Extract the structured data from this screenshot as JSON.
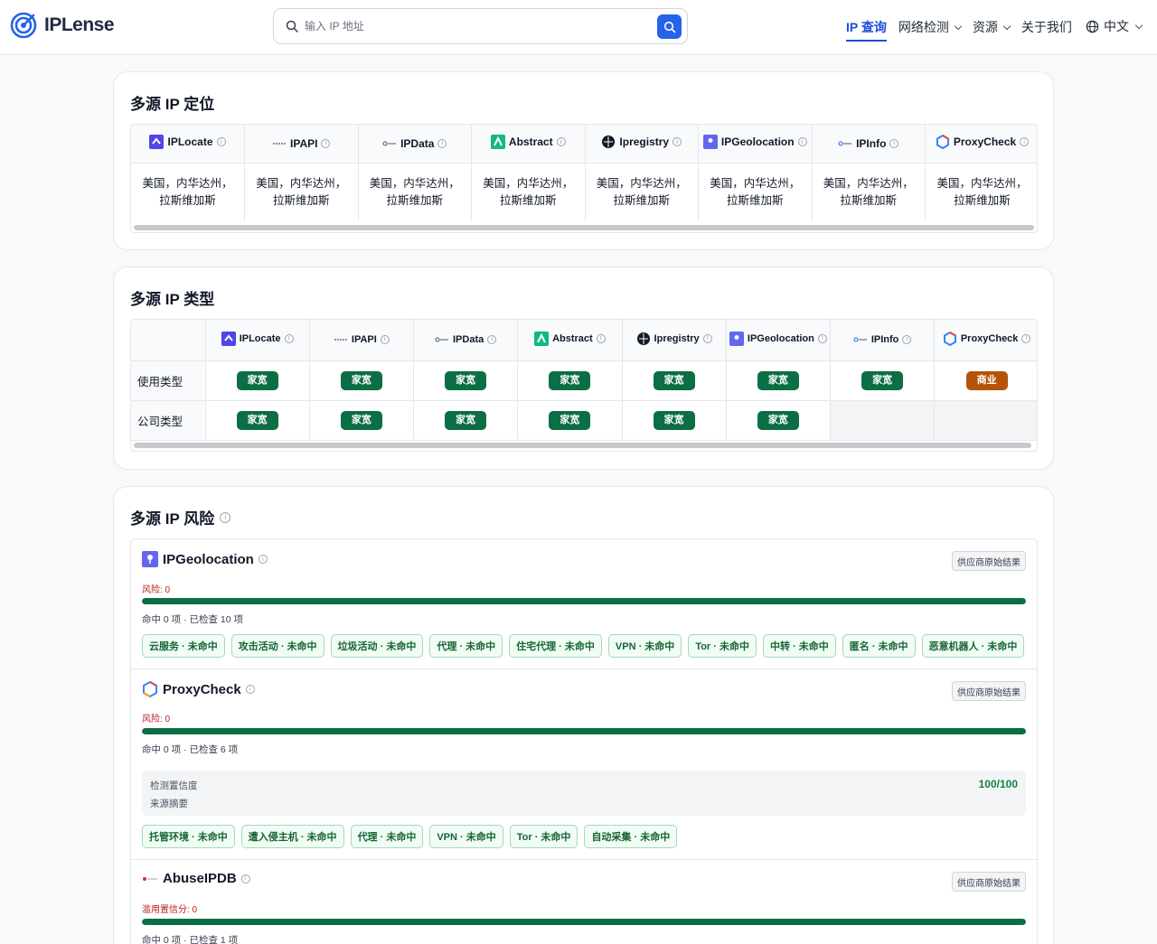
{
  "app": {
    "name": "IPLense"
  },
  "search": {
    "placeholder": "输入 IP 地址"
  },
  "nav": {
    "items": [
      {
        "label": "IP 查询",
        "active": true,
        "dropdown": false
      },
      {
        "label": "网络检测",
        "active": false,
        "dropdown": true
      },
      {
        "label": "资源",
        "active": false,
        "dropdown": true
      },
      {
        "label": "关于我们",
        "active": false,
        "dropdown": false
      }
    ],
    "language": "中文"
  },
  "providers": [
    "IPLocate",
    "IPAPI",
    "IPData",
    "Abstract",
    "Ipregistry",
    "IPGeolocation",
    "IPInfo",
    "ProxyCheck"
  ],
  "location_section": {
    "title": "多源 IP 定位",
    "values": [
      "美国，内华达州，拉斯维加斯",
      "美国，内华达州，拉斯维加斯",
      "美国，内华达州，拉斯维加斯",
      "美国，内华达州，拉斯维加斯",
      "美国，内华达州，拉斯维加斯",
      "美国，内华达州，拉斯维加斯",
      "美国，内华达州，拉斯维加斯",
      "美国，内华达州，拉斯维加斯"
    ]
  },
  "type_section": {
    "title": "多源 IP 类型",
    "rows": [
      {
        "label": "使用类型",
        "values": [
          "家宽",
          "家宽",
          "家宽",
          "家宽",
          "家宽",
          "家宽",
          "家宽",
          "商业"
        ]
      },
      {
        "label": "公司类型",
        "values": [
          "家宽",
          "家宽",
          "家宽",
          "家宽",
          "家宽",
          "家宽",
          "",
          ""
        ]
      }
    ]
  },
  "risk_section": {
    "title": "多源 IP 风险",
    "raw_button": "供应商原始结果",
    "items": [
      {
        "name": "IPGeolocation",
        "score_text": "风险: 0",
        "score": 0,
        "hits_text": "命中 0 项 · 已检查 10 项",
        "chips": [
          "云服务 · 未命中",
          "攻击活动 · 未命中",
          "垃圾活动 · 未命中",
          "代理 · 未命中",
          "住宅代理 · 未命中",
          "VPN · 未命中",
          "Tor · 未命中",
          "中转 · 未命中",
          "匿名 · 未命中",
          "恶意机器人 · 未命中"
        ]
      },
      {
        "name": "ProxyCheck",
        "score_text": "风险: 0",
        "score": 0,
        "hits_text": "命中 0 项 · 已检查 6 项",
        "confidence_label": "检测置信度",
        "confidence_value": "100/100",
        "source_summary": "来源摘要",
        "chips": [
          "托管环境 · 未命中",
          "遭入侵主机 · 未命中",
          "代理 · 未命中",
          "VPN · 未命中",
          "Tor · 未命中",
          "自动采集 · 未命中"
        ]
      },
      {
        "name": "AbuseIPDB",
        "score_text": "滥用置信分: 0",
        "score": 0,
        "hits_text": "命中 0 项 · 已检查 1 项"
      }
    ]
  },
  "colors": {
    "accent": "#2563eb",
    "nav_active": "#1d4ed8",
    "badge_green": "#0b6e44",
    "badge_orange": "#b45309",
    "risk_red": "#b91c1c"
  }
}
